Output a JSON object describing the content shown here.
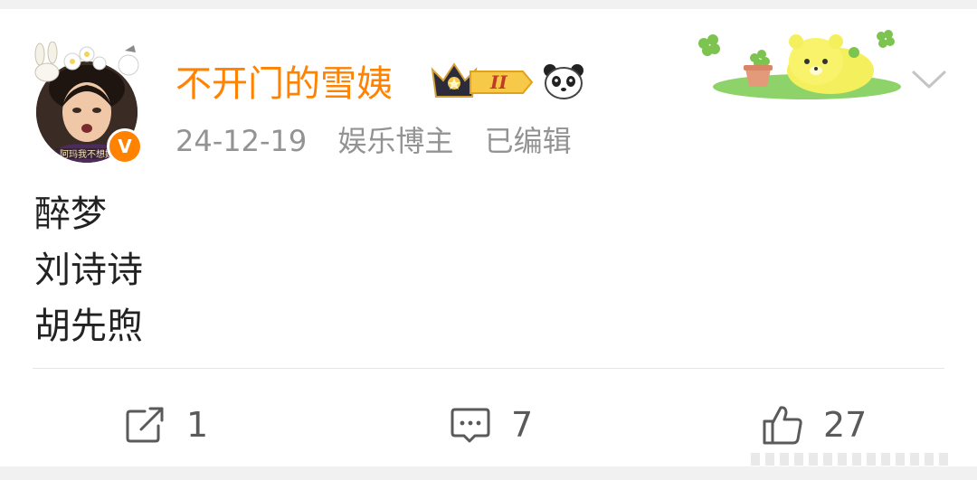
{
  "post": {
    "author": {
      "name": "不开门的雪姨",
      "verified_badge": "V",
      "avatar_caption": "阿玛我不想嫁",
      "crown_level": "II"
    },
    "meta": {
      "date": "24-12-19",
      "role": "娱乐博主",
      "edited": "已编辑"
    },
    "content_lines": [
      "醉梦",
      "刘诗诗",
      "胡先煦"
    ],
    "actions": {
      "repost_count": "1",
      "comment_count": "7",
      "like_count": "27"
    }
  },
  "icons": {
    "avatar_frame": "bunny-flower-frame-icon",
    "crown": "crown-level-icon",
    "panda": "panda-icon",
    "decoration": "yellow-bear-clover-icon",
    "menu": "chevron-down-icon",
    "repost": "share-square-arrow-icon",
    "comment": "comment-bubble-icon",
    "like": "thumbs-up-icon"
  },
  "colors": {
    "accent": "#ff8200",
    "meta_text": "#939393",
    "body_text": "#222222",
    "action_icon": "#5a5a5a"
  }
}
